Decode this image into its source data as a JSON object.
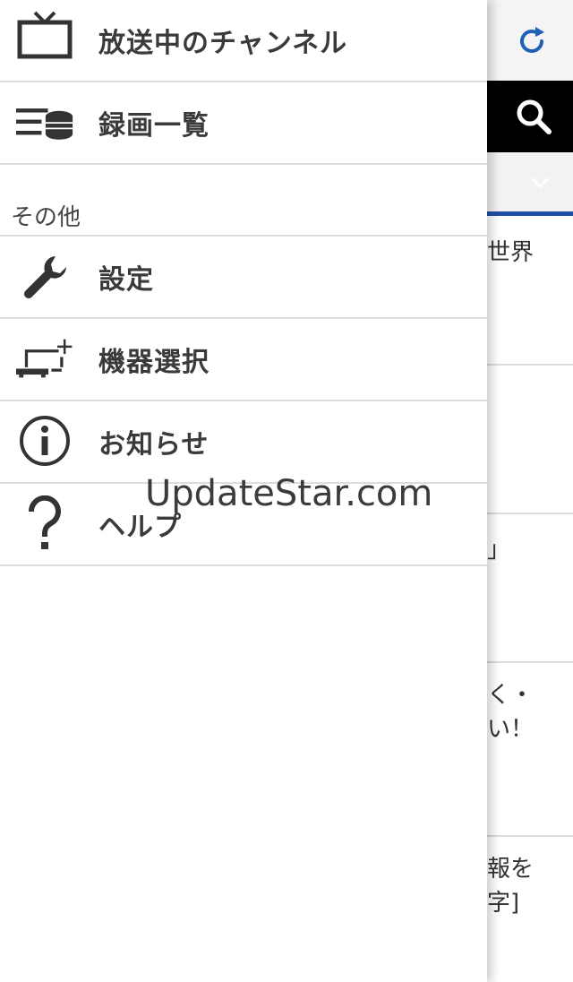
{
  "drawer": {
    "items_top": [
      {
        "label": "放送中のチャンネル",
        "icon": "tv-icon"
      },
      {
        "label": "録画一覧",
        "icon": "recordings-list-icon"
      }
    ],
    "section_label": "その他",
    "items_other": [
      {
        "label": "設定",
        "icon": "wrench-icon"
      },
      {
        "label": "機器選択",
        "icon": "device-add-icon"
      },
      {
        "label": "お知らせ",
        "icon": "info-icon"
      },
      {
        "label": "ヘルプ",
        "icon": "help-icon"
      }
    ]
  },
  "background": {
    "snippets": [
      "世界",
      "」",
      "く・",
      "い！",
      "報を",
      "字]"
    ]
  },
  "watermark": "UpdateStar.com",
  "colors": {
    "accent_blue": "#1f4fa8",
    "search_bar_bg": "#000000",
    "refresh_icon": "#1f5fb8"
  }
}
